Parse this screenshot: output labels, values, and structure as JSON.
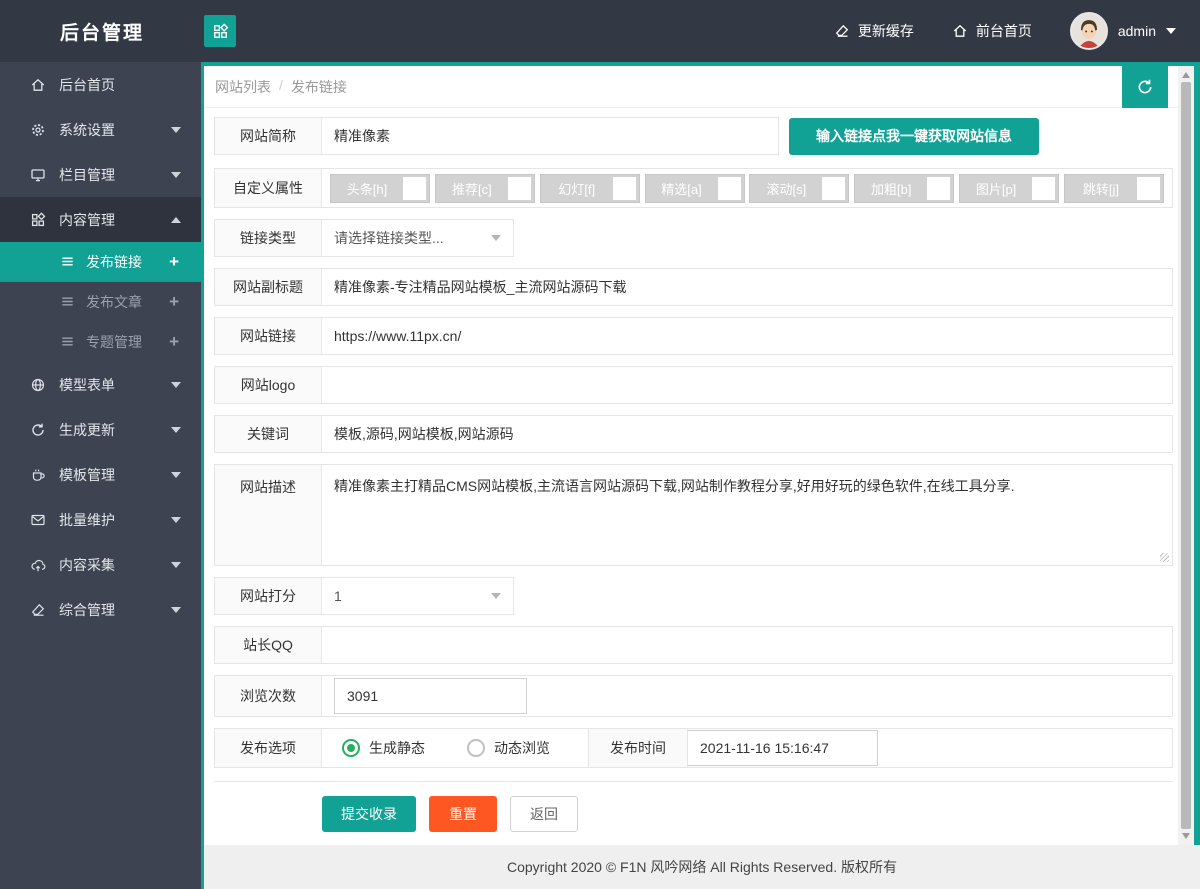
{
  "colors": {
    "accent": "#12a195",
    "radio_green": "#27ae60",
    "danger": "#ff5722",
    "dark": "#333845",
    "sidebar": "#3d4350"
  },
  "header": {
    "title": "后台管理",
    "refresh_cache": "更新缓存",
    "front_home": "前台首页",
    "username": "admin"
  },
  "sidebar": {
    "home": "后台首页",
    "system": "系统设置",
    "columns": "栏目管理",
    "content": "内容管理",
    "sub_publish_link": "发布链接",
    "sub_publish_article": "发布文章",
    "sub_topic": "专题管理",
    "model_form": "模型表单",
    "generate": "生成更新",
    "template": "模板管理",
    "batch": "批量维护",
    "collect": "内容采集",
    "misc": "综合管理",
    "plus": "+"
  },
  "breadcrumb": {
    "parent": "网站列表",
    "separator": "/",
    "current": "发布链接"
  },
  "form": {
    "site_name": {
      "label": "网站简称",
      "value": "精准像素"
    },
    "fetch_button": "输入链接点我一键获取网站信息",
    "attrs": {
      "label": "自定义属性",
      "options": [
        "头条[h]",
        "推荐[c]",
        "幻灯[f]",
        "精选[a]",
        "滚动[s]",
        "加粗[b]",
        "图片[p]",
        "跳转[j]"
      ]
    },
    "link_type": {
      "label": "链接类型",
      "value": "请选择链接类型..."
    },
    "subtitle": {
      "label": "网站副标题",
      "value": "精准像素-专注精品网站模板_主流网站源码下载"
    },
    "url": {
      "label": "网站链接",
      "value": "https://www.11px.cn/"
    },
    "logo": {
      "label": "网站logo",
      "value": ""
    },
    "keywords": {
      "label": "关键词",
      "value": "模板,源码,网站模板,网站源码"
    },
    "description": {
      "label": "网站描述",
      "value": "精准像素主打精品CMS网站模板,主流语言网站源码下载,网站制作教程分享,好用好玩的绿色软件,在线工具分享."
    },
    "score": {
      "label": "网站打分",
      "value": "1"
    },
    "qq": {
      "label": "站长QQ",
      "value": ""
    },
    "views": {
      "label": "浏览次数",
      "value": "3091"
    },
    "publish": {
      "label": "发布选项",
      "option_static": "生成静态",
      "option_dynamic": "动态浏览",
      "selected": "生成静态",
      "time_label": "发布时间",
      "time_value": "2021-11-16 15:16:47"
    },
    "buttons": {
      "submit": "提交收录",
      "reset": "重置",
      "back": "返回"
    }
  },
  "footer": {
    "copyright": "Copyright 2020 © F1N 风吟网络 All Rights Reserved. 版权所有"
  }
}
